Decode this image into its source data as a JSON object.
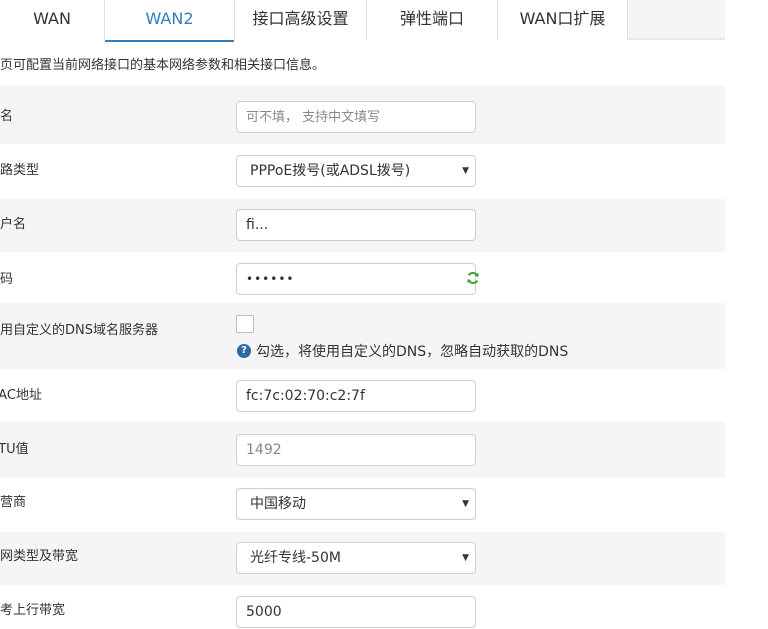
{
  "tabs": [
    {
      "label": "WAN"
    },
    {
      "label": "WAN2"
    },
    {
      "label": "接口高级设置"
    },
    {
      "label": "弹性端口"
    },
    {
      "label": "WAN口扩展"
    }
  ],
  "description": "本页可配置当前网络接口的基本网络参数和相关接口信息。",
  "form": {
    "alias": {
      "label": "别名",
      "placeholder": "可不填， 支持中文填写"
    },
    "line_type": {
      "label": "线路类型",
      "value": "PPPoE拨号(或ADSL拨号)"
    },
    "username": {
      "label": "用户名",
      "value": "fi..."
    },
    "password": {
      "label": "密码",
      "value": "••••••"
    },
    "custom_dns": {
      "label": "使用自定义的DNS域名服务器",
      "hint": "勾选，将使用自定义的DNS，忽略自动获取的DNS"
    },
    "mac": {
      "label": "MAC地址",
      "value": "fc:7c:02:70:c2:7f"
    },
    "mtu": {
      "label": "MTU值",
      "value": "1492"
    },
    "isp": {
      "label": "运营商",
      "value": "中国移动"
    },
    "bandwidth": {
      "label": "上网类型及带宽",
      "value": "光纤专线-50M"
    },
    "upload": {
      "label": "参考上行带宽",
      "value": "5000"
    }
  },
  "colors": {
    "accent": "#2f7fc1",
    "refresh": "#3aa33a",
    "hint_icon": "#2d6aa3"
  }
}
